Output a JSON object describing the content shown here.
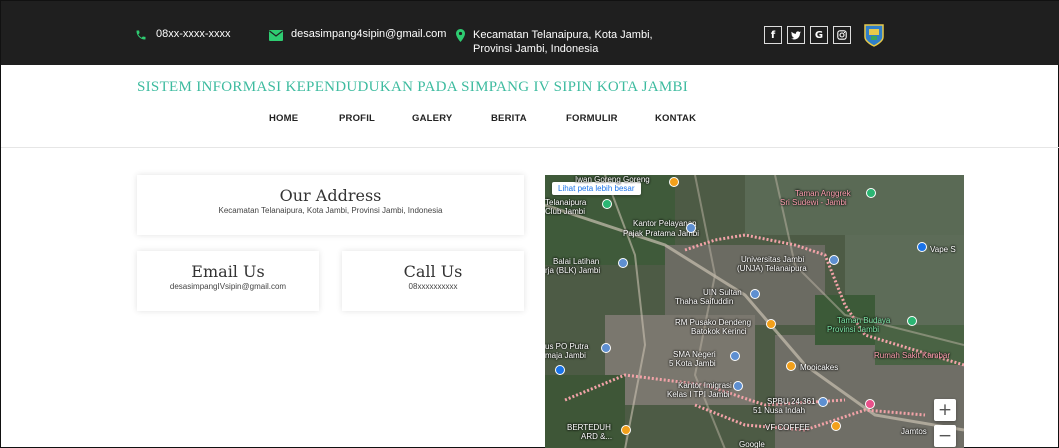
{
  "topbar": {
    "phone": "08xx-xxxx-xxxx",
    "email": "desasimpang4sipin@gmail.com",
    "address_line1": "Kecamatan Telanaipura, Kota Jambi,",
    "address_line2": "Provinsi Jambi, Indonesia",
    "social_icons": [
      "facebook-icon",
      "twitter-icon",
      "google-icon",
      "instagram-icon"
    ],
    "social_glyphs": [
      "f",
      "❧",
      "G",
      "◎"
    ],
    "accent_color": "#2ecc71"
  },
  "header": {
    "site_title": "SISTEM INFORMASI KEPENDUDUKAN PADA SIMPANG IV SIPIN KOTA JAMBI",
    "title_color": "#3dbb9f"
  },
  "nav": {
    "items": [
      {
        "label": "HOME"
      },
      {
        "label": "PROFIL"
      },
      {
        "label": "GALERY"
      },
      {
        "label": "BERITA"
      },
      {
        "label": "FORMULIR"
      },
      {
        "label": "KONTAK"
      }
    ]
  },
  "contact": {
    "address_title": "Our Address",
    "address_text": "Kecamatan Telanaipura, Kota Jambi, Provinsi Jambi, Indonesia",
    "email_title": "Email Us",
    "email_text": "desasimpangIVsipin@gmail.com",
    "call_title": "Call Us",
    "call_text": "08xxxxxxxxxx"
  },
  "map": {
    "larger_map_link": "Lihat peta lebih besar",
    "zoom_in": "+",
    "zoom_out": "−",
    "labels": {
      "l1": "Iwan Goreng Goreng",
      "l2": "Telanaipura",
      "l3": "Club Jambi",
      "l4": "Kantor Pelayanan",
      "l5": "Pajak Pratama Jambi",
      "l6": "Taman Anggrek",
      "l7": "Sri Sudewi - Jambi",
      "l8": "Balai Latihan",
      "l9": "rja (BLK) Jambi",
      "l10": "Universitas Jambi",
      "l11": "(UNJA) Telanaipura",
      "l12": "Vape S",
      "l13": "UIN Sultan",
      "l14": "Thaha Saifuddin",
      "l15": "RM Pusako Dendeng",
      "l16": "Batokok Kerinci",
      "l17": "Taman Budaya",
      "l18": "Provinsi Jambi",
      "l19": "us PO Putra",
      "l20": "maja Jambi",
      "l21": "SMA Negeri",
      "l22": "5 Kota Jambi",
      "l23": "Mooicakes",
      "l24": "Rumah Sakit Kambar",
      "l25": "Kantor Imigrasi",
      "l26": "Kelas I TPI Jambi",
      "l27": "SPBU 24.361",
      "l28": "51 Nusa Indah",
      "l29": "BERTEDUH",
      "l30": "ARD &...",
      "l31": "VF COFFEE",
      "l32": "Jamtos",
      "l33": "Google"
    }
  }
}
